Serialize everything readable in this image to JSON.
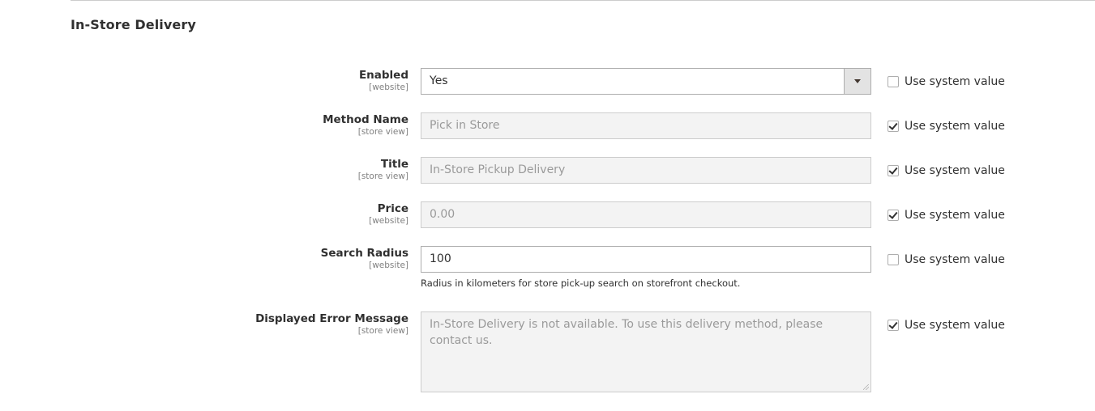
{
  "section": {
    "title": "In-Store Delivery"
  },
  "fields": [
    {
      "label": "Enabled",
      "scope": "[website]",
      "type": "select",
      "value": "Yes",
      "disabled": false,
      "use_system_value": false
    },
    {
      "label": "Method Name",
      "scope": "[store view]",
      "type": "text",
      "value": "Pick in Store",
      "disabled": true,
      "use_system_value": true
    },
    {
      "label": "Title",
      "scope": "[store view]",
      "type": "text",
      "value": "In-Store Pickup Delivery",
      "disabled": true,
      "use_system_value": true
    },
    {
      "label": "Price",
      "scope": "[website]",
      "type": "text",
      "value": "0.00",
      "disabled": true,
      "use_system_value": true
    },
    {
      "label": "Search Radius",
      "scope": "[website]",
      "type": "text",
      "value": "100",
      "disabled": false,
      "use_system_value": false,
      "note": "Radius in kilometers for store pick-up search on storefront checkout."
    },
    {
      "label": "Displayed Error Message",
      "scope": "[store view]",
      "type": "textarea",
      "value": "In-Store Delivery is not available. To use this delivery method, please contact us.",
      "disabled": true,
      "use_system_value": true
    }
  ],
  "use_system_value_label": "Use system value"
}
